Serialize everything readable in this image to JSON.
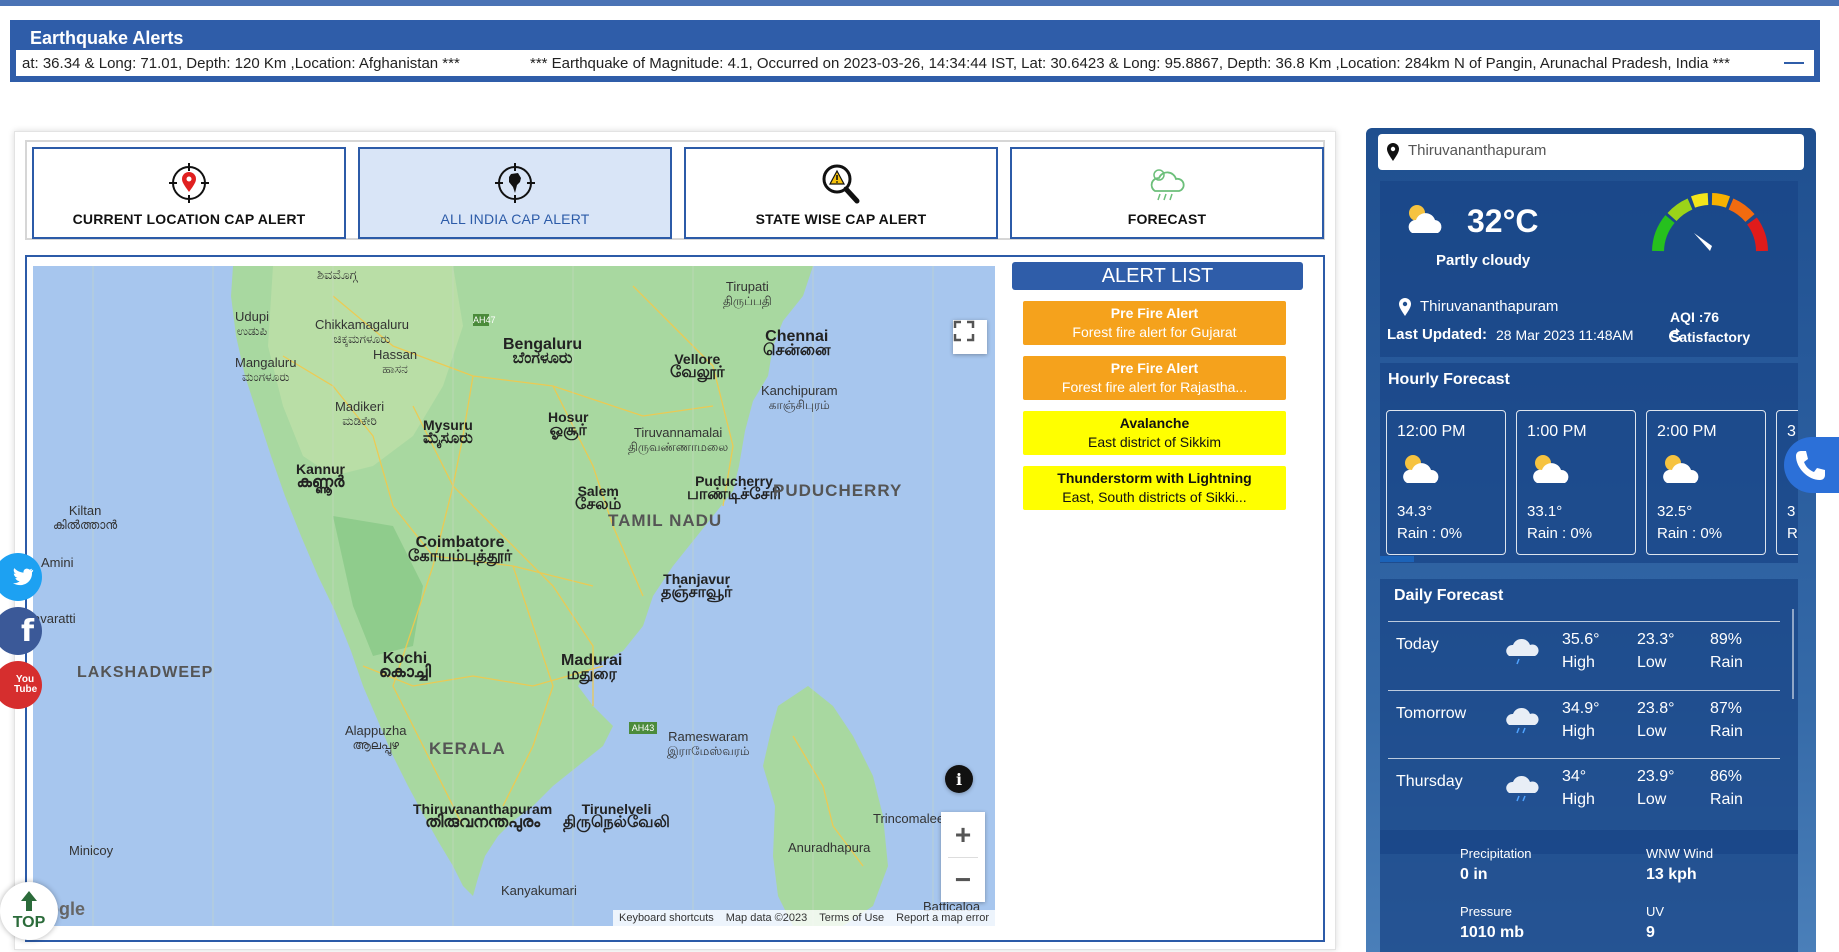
{
  "header": {
    "title": "Earthquake Alerts",
    "ticker": [
      "at: 36.34 & Long: 71.01, Depth: 120 Km ,Location: Afghanistan ***",
      "*** Earthquake of Magnitude: 4.1, Occurred on 2023-03-26, 14:34:44 IST, Lat: 30.6423 & Long: 95.8867, Depth: 36.8 Km ,Location: 284km N of Pangin, Arunachal Pradesh, India ***"
    ]
  },
  "tabs": [
    {
      "label": "CURRENT LOCATION CAP ALERT",
      "icon": "location-pin-icon"
    },
    {
      "label": "ALL INDIA CAP ALERT",
      "icon": "india-map-icon"
    },
    {
      "label": "STATE WISE CAP ALERT",
      "icon": "magnifier-warning-icon"
    },
    {
      "label": "FORECAST",
      "icon": "cloud-rain-icon"
    }
  ],
  "map": {
    "labels": {
      "tirupati": "Tirupati",
      "tirupati_loc": "திருப்பதி",
      "udupi": "Udupi",
      "udupi_loc": "ಉಡುಪಿ",
      "chikkamagaluru": "Chikkamagaluru",
      "chikkamagaluru_loc": "ಚಿಕ್ಕಮಗಳೂರು",
      "hassan": "Hassan",
      "hassan_loc": "ಹಾಸನ",
      "mangaluru": "Mangaluru",
      "mangaluru_loc": "ಮಂಗಳೂರು",
      "bengaluru": "Bengaluru",
      "bengaluru_loc": "ಬೆಂಗಳೂರು",
      "vellore": "Vellore",
      "vellore_loc": "வேலூர்",
      "chennai": "Chennai",
      "chennai_loc": "சென்னை",
      "kanchipuram": "Kanchipuram",
      "kanchipuram_loc": "காஞ்சிபுரம்",
      "madikeri": "Madikeri",
      "madikeri_loc": "ಮಡಿಕೇರಿ",
      "mysuru": "Mysuru",
      "mysuru_loc": "ಮೈಸೂರು",
      "hosur": "Hosur",
      "hosur_loc": "ஓசூர்",
      "tiruvannamalai": "Tiruvannamalai",
      "tiruvannamalai_loc": "திருவண்ணாமலை",
      "kannur": "Kannur",
      "kannur_loc": "കണ്ണൂർ",
      "salem": "Salem",
      "salem_loc": "சேலம்",
      "puducherry": "Puducherry",
      "puducherry_loc": "பாண்டிச்சேரி",
      "puducherry_state": "PUDUCHERRY",
      "kiltan": "Kiltan",
      "kiltan_loc": "കിൽത്താൻ",
      "tamil_nadu": "TAMIL NADU",
      "amini": "Amini",
      "coimbatore": "Coimbatore",
      "coimbatore_loc": "கோயம்புத்தூர்",
      "thanjavur": "Thanjavur",
      "thanjavur_loc": "தஞ்சாவூர்",
      "kavaratti": "avaratti",
      "lakshadweep": "LAKSHADWEEP",
      "kochi": "Kochi",
      "kochi_loc": "കൊച്ചി",
      "madurai": "Madurai",
      "madurai_loc": "மதுரை",
      "alappuzha": "Alappuzha",
      "alappuzha_loc": "ആലപ്പുഴ",
      "kerala": "KERALA",
      "rameswaram": "Rameswaram",
      "rameswaram_loc": "இராமேஸ்வரம்",
      "thiruvananthapuram": "Thiruvananthapuram",
      "thiruvananthapuram_loc": "തിരുവനന്തപുരം",
      "tirunelveli": "Tirunelveli",
      "tirunelveli_loc": "திருநெல்வேலி",
      "trincomalee": "Trincomalee",
      "anuradhapura": "Anuradhapura",
      "minicoy": "Minicoy",
      "kanyakumari": "Kanyakumari",
      "batticaloa": "Batticaloa",
      "shivamogga_loc": "ಶಿವಮೊಗ್ಗ",
      "ah47": "AH47",
      "ah43": "AH43"
    },
    "zoom_in": "+",
    "zoom_out": "−",
    "google": "oogle",
    "attribution": [
      "Keyboard shortcuts",
      "Map data ©2023",
      "Terms of Use",
      "Report a map error"
    ]
  },
  "alerts": {
    "header": "ALERT LIST",
    "items": [
      {
        "title": "Pre Fire Alert",
        "desc": "Forest fire alert for Gujarat",
        "color": "#f5a21c"
      },
      {
        "title": "Pre Fire Alert",
        "desc": "Forest fire alert for Rajastha...",
        "color": "#f5a21c"
      },
      {
        "title": "Avalanche",
        "desc": "East district of Sikkim",
        "color": "#ffff00"
      },
      {
        "title": "Thunderstorm with Lightning",
        "desc": "East, South districts of Sikki...",
        "color": "#ffff00"
      }
    ]
  },
  "weather": {
    "search_value": "Thiruvananthapuram",
    "temp": "32°C",
    "condition": "Partly cloudy",
    "aqi": "AQI :76",
    "aqi_category": "Satisfactory",
    "location": "Thiruvananthapuram",
    "last_updated_label": "Last Updated:",
    "last_updated_value": "28 Mar 2023 11:48AM",
    "hourly_title": "Hourly Forecast",
    "hourly": [
      {
        "time": "12:00 PM",
        "temp": "34.3°",
        "rain": "Rain : 0%"
      },
      {
        "time": "1:00 PM",
        "temp": "33.1°",
        "rain": "Rain : 0%"
      },
      {
        "time": "2:00 PM",
        "temp": "32.5°",
        "rain": "Rain : 0%"
      },
      {
        "time": "3",
        "temp": "3",
        "rain": "R"
      }
    ],
    "daily_title": "Daily Forecast",
    "daily": [
      {
        "day": "Today",
        "high": "35.6°",
        "high_lbl": "High",
        "low": "23.3°",
        "low_lbl": "Low",
        "rain": "89%",
        "rain_lbl": "Rain"
      },
      {
        "day": "Tomorrow",
        "high": "34.9°",
        "high_lbl": "High",
        "low": "23.8°",
        "low_lbl": "Low",
        "rain": "87%",
        "rain_lbl": "Rain"
      },
      {
        "day": "Thursday",
        "high": "34°",
        "high_lbl": "High",
        "low": "23.9°",
        "low_lbl": "Low",
        "rain": "86%",
        "rain_lbl": "Rain"
      }
    ],
    "details": {
      "precip_lbl": "Precipitation",
      "precip": "0 in",
      "wind_lbl": "WNW Wind",
      "wind": "13 kph",
      "pressure_lbl": "Pressure",
      "pressure": "1010 mb",
      "uv_lbl": "UV",
      "uv": "9"
    }
  },
  "floating": {
    "top_label": "TOP",
    "youtube_label": "You Tube"
  },
  "colors": {
    "primary": "#2f5da9",
    "alert_orange": "#f5a21c",
    "alert_yellow": "#ffff00",
    "phone": "#2c70d8"
  }
}
